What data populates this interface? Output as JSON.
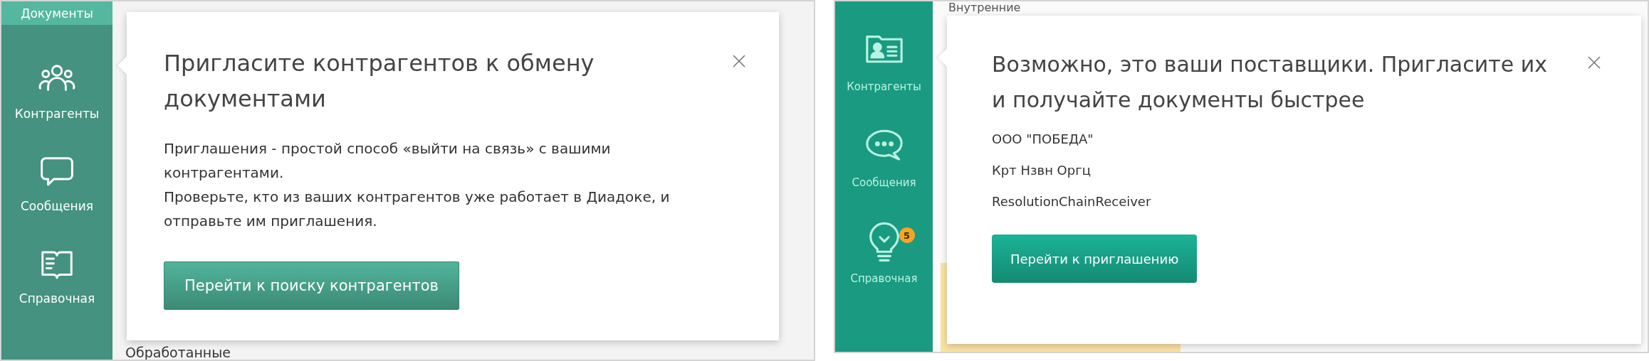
{
  "panels": [
    {
      "sidebar": {
        "items": [
          {
            "kind": "documents",
            "label": "Документы",
            "selected": true
          },
          {
            "kind": "people",
            "label": "Контрагенты",
            "selected": false
          },
          {
            "kind": "chat",
            "label": "Сообщения",
            "selected": false
          },
          {
            "kind": "book",
            "label": "Справочная",
            "selected": false
          }
        ]
      },
      "background": {
        "labels": [
          "Обработанные"
        ]
      },
      "popup": {
        "title": "Пригласите контрагентов к обмену документами",
        "paragraphs": [
          "Приглашения - простой способ «выйти на связь» с вашими контрагентами.",
          "Проверьте, кто из ваших контрагентов уже работает в Диадоке, и отправьте им приглашения."
        ],
        "button": "Перейти к поиску контрагентов"
      }
    },
    {
      "sidebar": {
        "items": [
          {
            "kind": "card",
            "label": "Контрагенты",
            "selected": false
          },
          {
            "kind": "chat-dots",
            "label": "Сообщения",
            "selected": false
          },
          {
            "kind": "bulb",
            "label": "Справочная",
            "selected": false,
            "badge": "5"
          }
        ]
      },
      "background": {
        "labels": [
          "Внутренние"
        ]
      },
      "popup": {
        "title": "Возможно, это ваши поставщики. Пригласите их и получайте документы быстрее",
        "suggestions": [
          "ООО \"ПОБЕДА\"",
          "Крт Нзвн Оргц",
          "ResolutionChainReceiver"
        ],
        "button": "Перейти к приглашению"
      }
    }
  ]
}
